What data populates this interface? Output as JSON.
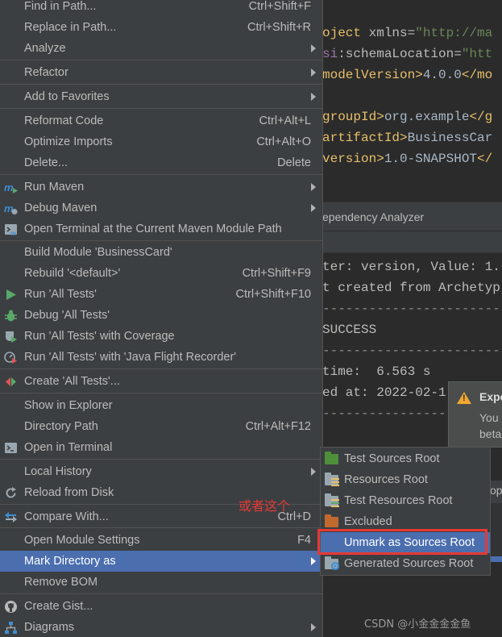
{
  "editor": {
    "lines": [
      {
        "pre": "",
        "tag": "oject",
        "rest": " xmlns=",
        "str": "\"http://ma"
      },
      {
        "pre": "",
        "ns": "si",
        "rest": ":schemaLocation=",
        "str": "\"htt"
      },
      {
        "pre": "",
        "tag": "modelVersion>",
        "txt": "4.0.0",
        "tag2": "</mo"
      },
      {
        "pre": "",
        "tag": "groupId>",
        "txt": "org.example",
        "tag2": "</g"
      },
      {
        "pre": "",
        "tag": "artifactId>",
        "txt": "BusinessCar"
      },
      {
        "pre": "",
        "tag": "version>",
        "txt": "1.0-SNAPSHOT",
        "tag2": "</"
      }
    ],
    "dependency_tab": "ependency Analyzer",
    "console": [
      "ter: version, Value: 1.",
      "t created from Archetyp",
      "------------------------",
      "SUCCESS",
      "------------------------",
      "time:  6.563 s",
      "ed at: 2022-02-1",
      "----------------"
    ],
    "notification": {
      "title": "Expe",
      "line1": "You",
      "line2": "beta"
    },
    "side_fragment": "op"
  },
  "menu": {
    "items": [
      {
        "label": "Find in Path...",
        "shortcut": "Ctrl+Shift+F"
      },
      {
        "label": "Replace in Path...",
        "shortcut": "Ctrl+Shift+R"
      },
      {
        "label": "Analyze",
        "submenu": true
      },
      {
        "label": "Refactor",
        "submenu": true
      },
      {
        "label": "Add to Favorites",
        "submenu": true
      },
      {
        "label": "Reformat Code",
        "shortcut": "Ctrl+Alt+L"
      },
      {
        "label": "Optimize Imports",
        "shortcut": "Ctrl+Alt+O"
      },
      {
        "label": "Delete...",
        "shortcut": "Delete"
      },
      {
        "label": "Run Maven",
        "submenu": true,
        "icon": "maven-run-icon"
      },
      {
        "label": "Debug Maven",
        "submenu": true,
        "icon": "maven-debug-icon"
      },
      {
        "label": "Open Terminal at the Current Maven Module Path",
        "icon": "maven-terminal-icon"
      },
      {
        "label": "Build Module 'BusinessCard'"
      },
      {
        "label": "Rebuild '<default>'",
        "shortcut": "Ctrl+Shift+F9"
      },
      {
        "label": "Run 'All Tests'",
        "shortcut": "Ctrl+Shift+F10",
        "icon": "run-icon"
      },
      {
        "label": "Debug 'All Tests'",
        "icon": "debug-icon"
      },
      {
        "label": "Run 'All Tests' with Coverage",
        "icon": "coverage-icon"
      },
      {
        "label": "Run 'All Tests' with 'Java Flight Recorder'",
        "icon": "profiler-icon"
      },
      {
        "label": "Create 'All Tests'...",
        "icon": "create-config-icon"
      },
      {
        "label": "Show in Explorer"
      },
      {
        "label": "Directory Path",
        "shortcut": "Ctrl+Alt+F12"
      },
      {
        "label": "Open in Terminal",
        "icon": "terminal-icon"
      },
      {
        "label": "Local History",
        "submenu": true
      },
      {
        "label": "Reload from Disk",
        "icon": "reload-icon"
      },
      {
        "label": "Compare With...",
        "shortcut": "Ctrl+D",
        "icon": "compare-icon"
      },
      {
        "label": "Open Module Settings",
        "shortcut": "F4"
      },
      {
        "label": "Mark Directory as",
        "submenu": true,
        "selected": true
      },
      {
        "label": "Remove BOM"
      },
      {
        "label": "Create Gist...",
        "icon": "github-icon"
      },
      {
        "label": "Diagrams",
        "submenu": true,
        "icon": "diagram-icon"
      }
    ]
  },
  "submenu": {
    "items": [
      {
        "label": "Test Sources Root",
        "icon": "test-sources-folder-icon",
        "color": "#4e8f3a"
      },
      {
        "label": "Resources Root",
        "icon": "resources-folder-icon",
        "color": "#9aa7b0"
      },
      {
        "label": "Test Resources Root",
        "icon": "test-resources-folder-icon",
        "color": "#9aa7b0"
      },
      {
        "label": "Excluded",
        "icon": "excluded-folder-icon",
        "color": "#c2692f"
      },
      {
        "label": "Unmark as Sources Root",
        "selected": true
      },
      {
        "label": "Generated Sources Root",
        "icon": "generated-sources-folder-icon",
        "color": "#9aa7b0"
      }
    ]
  },
  "annotation": {
    "text": "或者这个"
  },
  "watermark": "CSDN @小金金金金鱼",
  "colors": {
    "menu_bg": "#3c3f41",
    "selection": "#4b6eaf",
    "annotation_red": "#e53935",
    "editor_bg": "#2b2b2b"
  }
}
